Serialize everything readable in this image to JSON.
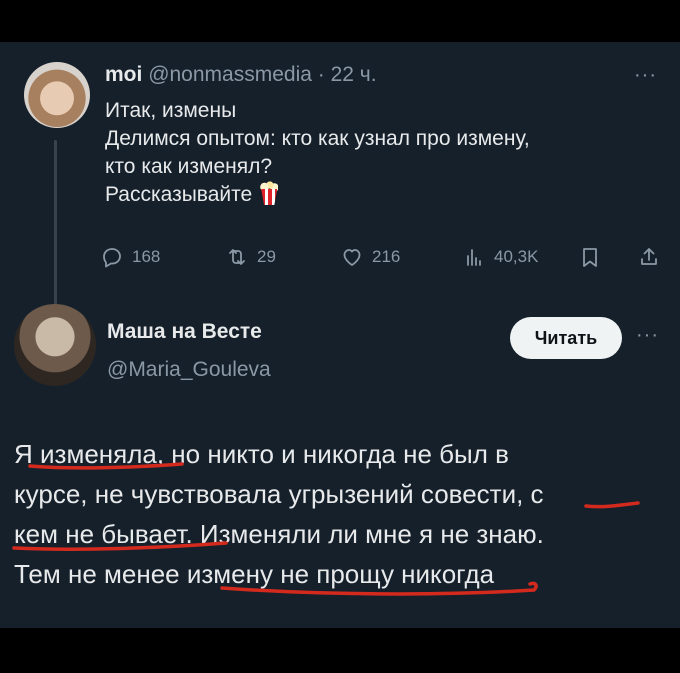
{
  "tweet1": {
    "author_name": "moi",
    "handle_time": "@nonmassmedia · 22 ч.",
    "lines": [
      "Итак, измены",
      "Делимся опытом: кто как узнал про измену,",
      "кто как изменял?",
      "Рассказывайте"
    ],
    "emoji": "popcorn-emoji",
    "metrics": {
      "replies": "168",
      "reposts": "29",
      "likes": "216",
      "views": "40,3K"
    }
  },
  "tweet2": {
    "author_name": "Маша на Весте",
    "handle": "@Maria_Gouleva",
    "follow_label": "Читать",
    "lines": [
      "Я изменяла, но никто и никогда не был в",
      "курсе, не чувствовала угрызений совести, с",
      "кем не бывает. Изменяли ли мне я не знаю.",
      "Тем не менее измену не прощу никогда"
    ],
    "underline_color": "#d42a1e"
  },
  "colors": {
    "background": "#15202b",
    "frame": "#000000",
    "text": "#e7e9ea",
    "muted": "#8b98a5"
  },
  "icons": [
    "reply-icon",
    "repost-icon",
    "like-icon",
    "views-icon",
    "bookmark-icon",
    "share-icon",
    "more-icon"
  ]
}
